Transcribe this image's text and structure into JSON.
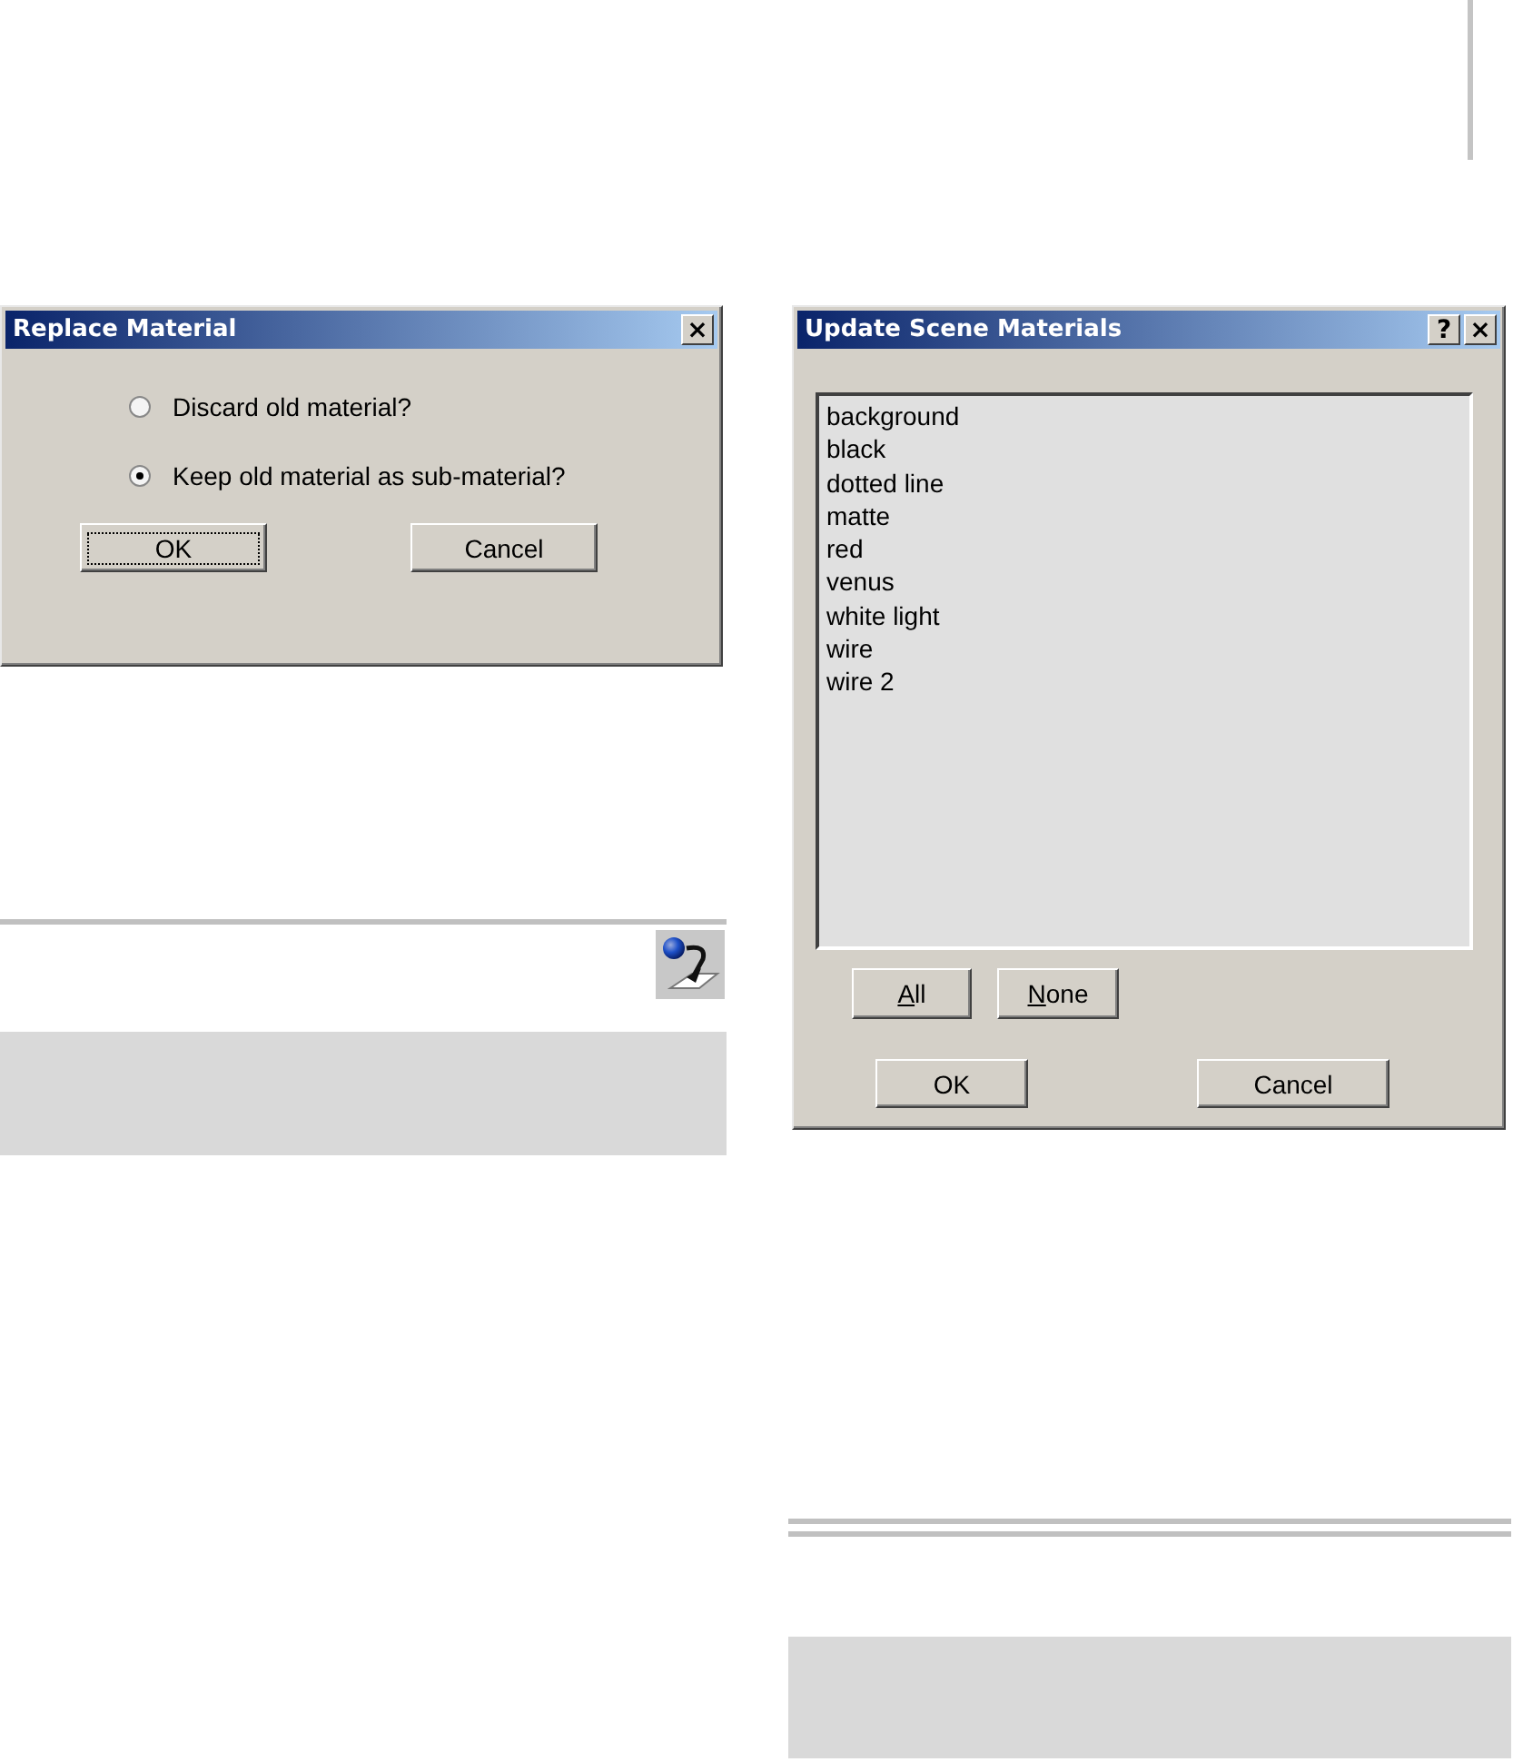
{
  "replace_dialog": {
    "title": "Replace Material",
    "close_button": "×",
    "options": [
      {
        "label": "Discard old material?",
        "selected": false
      },
      {
        "label": "Keep old material as sub-material?",
        "selected": true
      }
    ],
    "buttons": [
      {
        "label": "OK",
        "focused": true
      },
      {
        "label": "Cancel",
        "focused": false
      }
    ]
  },
  "update_dialog": {
    "title": "Update Scene Materials",
    "help_button": "?",
    "close_button": "×",
    "materials": [
      "background",
      "black",
      "dotted line",
      "matte",
      "red",
      "venus",
      "white light",
      "wire",
      "wire 2"
    ],
    "select_buttons": [
      {
        "accel": "A",
        "rest": "ll"
      },
      {
        "accel": "N",
        "rest": "one"
      }
    ],
    "buttons": [
      {
        "label": "OK",
        "focused": false
      },
      {
        "label": "Cancel",
        "focused": false
      }
    ]
  }
}
